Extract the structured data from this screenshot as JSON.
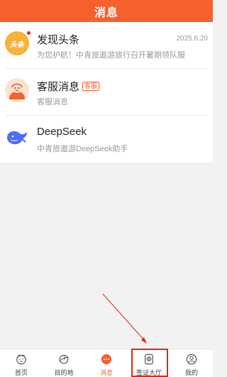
{
  "header": {
    "title": "消息"
  },
  "messages": [
    {
      "title": "发现头条",
      "preview": "为您护航！中青旅遨游旅行召开暑期领队服",
      "date": "2025.6.20",
      "avatar_text": "头条",
      "unread": true
    },
    {
      "title": "客服消息",
      "tag": "客服",
      "preview": "客服消息"
    },
    {
      "title": "DeepSeek",
      "preview": "中青旅遨游DeepSeek助手"
    }
  ],
  "tabbar": {
    "items": [
      {
        "label": "首页",
        "icon": "home-face-icon"
      },
      {
        "label": "目的地",
        "icon": "planet-icon"
      },
      {
        "label": "消息",
        "icon": "chat-bubble-icon",
        "active": true
      },
      {
        "label": "签证大厅",
        "icon": "passport-icon"
      },
      {
        "label": "我的",
        "icon": "user-icon"
      }
    ]
  },
  "colors": {
    "brand": "#f5602d",
    "annotation": "#e8231a"
  }
}
